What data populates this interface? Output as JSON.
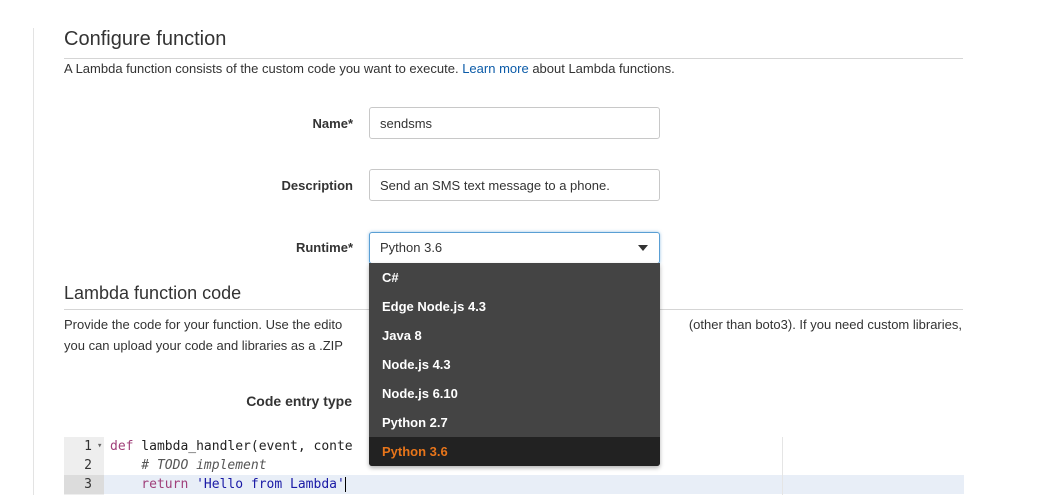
{
  "configure": {
    "title": "Configure function",
    "description_prefix": "A Lambda function consists of the custom code you want to execute.",
    "learn_more": "Learn more",
    "description_suffix": "about Lambda functions."
  },
  "form": {
    "name_label": "Name*",
    "name_value": "sendsms",
    "description_label": "Description",
    "description_value": "Send an SMS text message to a phone.",
    "runtime_label": "Runtime*",
    "runtime_value": "Python 3.6"
  },
  "runtime_options": [
    "C#",
    "Edge Node.js 4.3",
    "Java 8",
    "Node.js 4.3",
    "Node.js 6.10",
    "Python 2.7",
    "Python 3.6"
  ],
  "runtime_selected_index": 6,
  "code_section": {
    "title": "Lambda function code",
    "desc_line1_start": "Provide the code for your function. Use the edito",
    "desc_line1_end": "(other than boto3). If you need custom libraries,",
    "desc_line2": "you can upload your code and libraries as a .ZIP",
    "entry_type_label": "Code entry type"
  },
  "editor": {
    "line_numbers": [
      "1",
      "2",
      "3"
    ],
    "line1_kw": "def",
    "line1_rest": " lambda_handler(event, conte",
    "line2": "    # TODO implement",
    "line3_kw": "    return",
    "line3_str": " 'Hello from Lambda'"
  },
  "colors": {
    "link": "#0b5ba8",
    "dropdown_bg": "#444444",
    "dropdown_selected_bg": "#222222",
    "dropdown_selected_text": "#e8751a",
    "select_focus_border": "#5a9fd4"
  }
}
